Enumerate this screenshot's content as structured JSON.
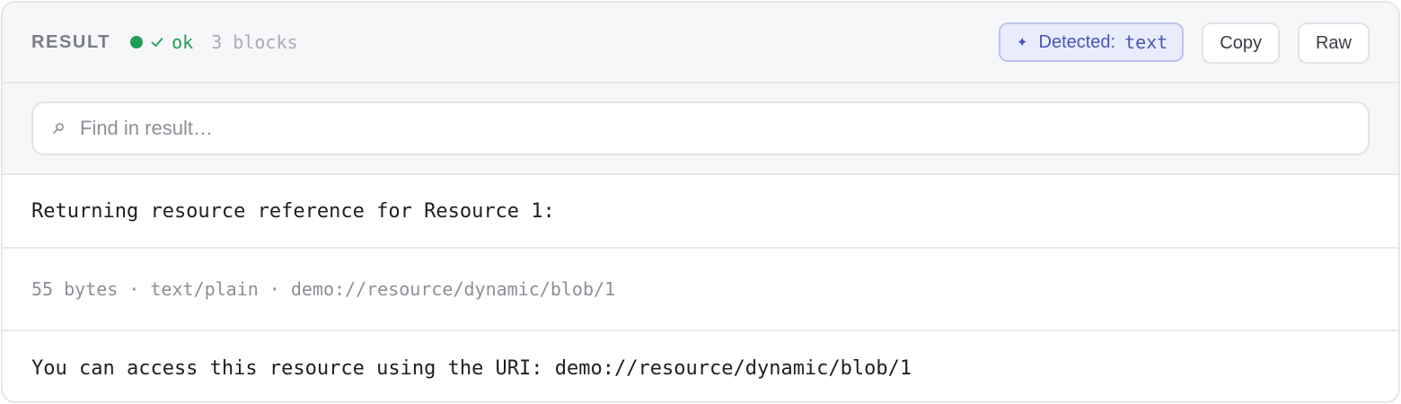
{
  "header": {
    "title": "RESULT",
    "status": "ok",
    "status_color": "#1e9e56",
    "block_count": "3 blocks",
    "detected_label": "Detected:",
    "detected_value": "text",
    "copy_label": "Copy",
    "raw_label": "Raw"
  },
  "search": {
    "placeholder": "Find in result…",
    "value": ""
  },
  "blocks": {
    "first_text": "Returning resource reference for Resource 1:",
    "resource_meta": {
      "size": "55 bytes",
      "mime": "text/plain",
      "uri": "demo://resource/dynamic/blob/1",
      "separator": "·"
    },
    "third_text": "You can access this resource using the URI: demo://resource/dynamic/blob/1"
  },
  "icons": {
    "status": "status-dot-icon",
    "check": "check-icon",
    "detected": "sparkle-icon",
    "search": "search-icon"
  },
  "colors": {
    "accent": "#4a55b8",
    "success": "#1e9e56"
  }
}
